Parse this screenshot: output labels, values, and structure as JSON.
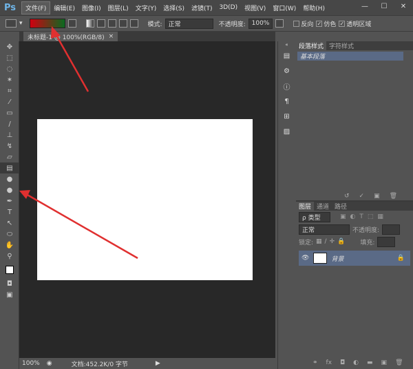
{
  "app": {
    "logo": "Ps"
  },
  "menu": [
    {
      "label": "文件(F)"
    },
    {
      "label": "编辑(E)"
    },
    {
      "label": "图像(I)"
    },
    {
      "label": "图层(L)"
    },
    {
      "label": "文字(Y)"
    },
    {
      "label": "选择(S)"
    },
    {
      "label": "滤镜(T)"
    },
    {
      "label": "3D(D)"
    },
    {
      "label": "视图(V)"
    },
    {
      "label": "窗口(W)"
    },
    {
      "label": "帮助(H)"
    }
  ],
  "window_controls": {
    "minimize": "—",
    "maximize": "☐",
    "close": "✕"
  },
  "options": {
    "gradient_colors": [
      "#d00010",
      "#0a6a20"
    ],
    "mode_label": "模式:",
    "mode_value": "正常",
    "opacity_label": "不透明度:",
    "opacity_value": "100%",
    "reverse": "反向",
    "reverse_checked": false,
    "dither": "仿色",
    "dither_checked": true,
    "transparency": "透明区域",
    "transparency_checked": true
  },
  "document": {
    "tab": "未标题-1 @ 100%(RGB/8)",
    "close": "×"
  },
  "status": {
    "zoom": "100%",
    "doc_info": "文档:452.2K/0 字节"
  },
  "paragraph_panel": {
    "tabs": [
      "段落样式",
      "字符样式"
    ],
    "item": "基本段落"
  },
  "layers_panel": {
    "tabs": [
      "图层",
      "通道",
      "路径"
    ],
    "filter": "ρ 类型",
    "blend": "正常",
    "opacity_label": "不透明度:",
    "lock_label": "锁定:",
    "fill_label": "填充:",
    "layers": [
      {
        "name": "背景",
        "locked": true,
        "visible": true
      }
    ]
  },
  "accent": "#e03030"
}
